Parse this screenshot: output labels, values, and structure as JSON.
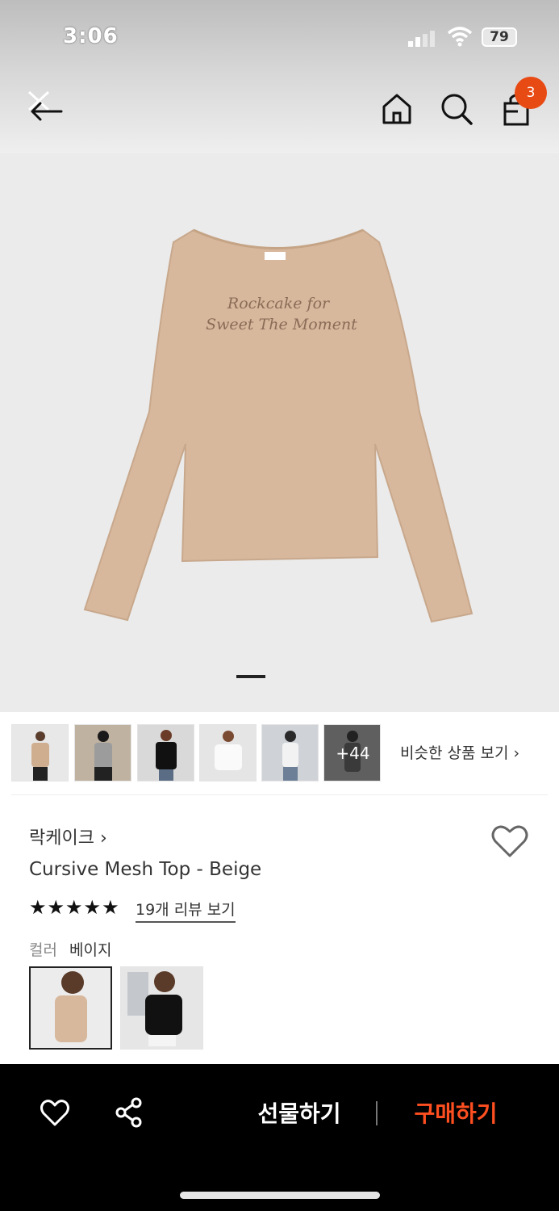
{
  "status_bar": {
    "time": "3:06",
    "battery": "79"
  },
  "header": {
    "cart_count": "3",
    "icons": [
      "back-arrow-icon",
      "close-icon",
      "home-icon",
      "search-icon",
      "shopping-bag-icon"
    ]
  },
  "hero": {
    "print_line_1": "Rockcake for",
    "print_line_2": "Sweet The Moment",
    "page_index": 1
  },
  "thumbnails": {
    "more_count": "+44",
    "similar_label": "비슷한 상품 보기 ›"
  },
  "product": {
    "brand": "락케이크 ›",
    "title": "Cursive Mesh Top - Beige",
    "rating": 5,
    "stars": "★★★★★",
    "reviews_label": "19개 리뷰 보기",
    "color_label": "컬러",
    "color_value": "베이지"
  },
  "bottom_bar": {
    "gift_label": "선물하기",
    "buy_label": "구매하기"
  },
  "colors": {
    "accent": "#e84a14",
    "buy": "#ff4f20",
    "garment_beige": "#d8b89d"
  }
}
